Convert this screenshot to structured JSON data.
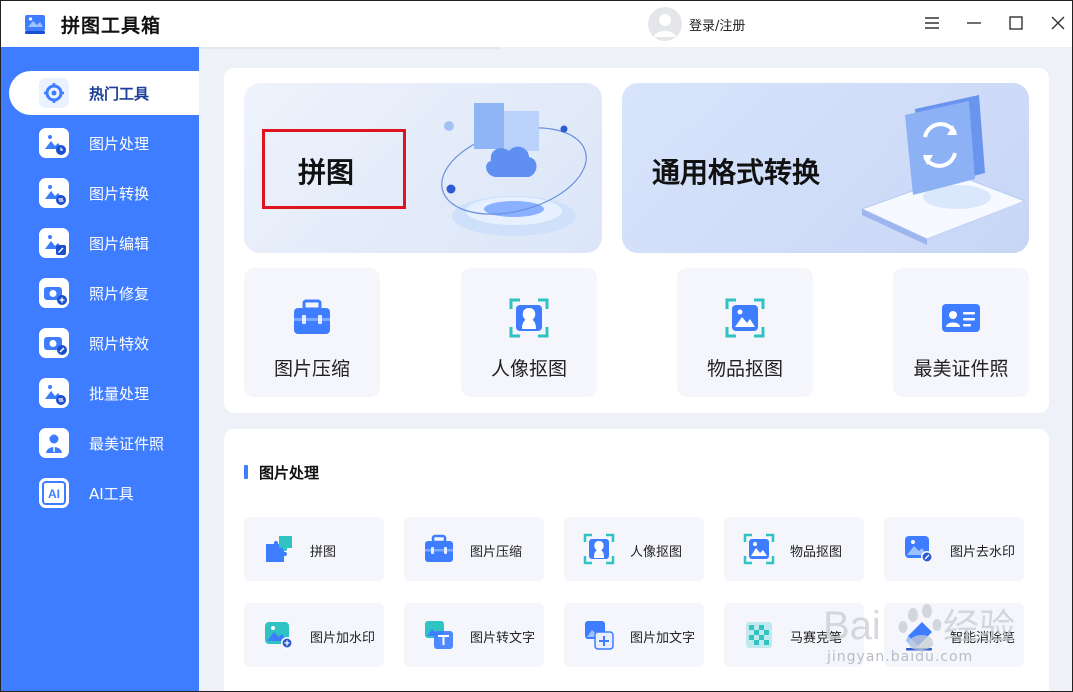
{
  "window": {
    "title": "拼图工具箱",
    "login_label": "登录/注册"
  },
  "sidebar": {
    "items": [
      {
        "label": "热门工具",
        "icon": "gear-tools-icon",
        "active": true
      },
      {
        "label": "图片处理",
        "icon": "image-clock-icon"
      },
      {
        "label": "图片转换",
        "icon": "image-convert-icon"
      },
      {
        "label": "图片编辑",
        "icon": "image-edit-icon"
      },
      {
        "label": "照片修复",
        "icon": "camera-plus-icon"
      },
      {
        "label": "照片特效",
        "icon": "camera-magic-icon"
      },
      {
        "label": "批量处理",
        "icon": "image-batch-icon"
      },
      {
        "label": "最美证件照",
        "icon": "id-person-icon"
      },
      {
        "label": "AI工具",
        "icon": "ai-icon"
      }
    ]
  },
  "hero": {
    "puzzle": {
      "label": "拼图",
      "icon": "puzzle-3d-icon"
    },
    "format": {
      "label": "通用格式转换",
      "icon": "format-convert-3d-icon"
    }
  },
  "top_tools": [
    {
      "label": "图片压缩",
      "icon": "toolbox-icon"
    },
    {
      "label": "人像抠图",
      "icon": "portrait-cutout-icon"
    },
    {
      "label": "物品抠图",
      "icon": "object-cutout-icon"
    },
    {
      "label": "最美证件照",
      "icon": "id-card-icon"
    }
  ],
  "section": {
    "title": "图片处理",
    "tools": [
      {
        "label": "拼图",
        "icon": "puzzle-icon"
      },
      {
        "label": "图片压缩",
        "icon": "toolbox-icon"
      },
      {
        "label": "人像抠图",
        "icon": "portrait-cutout-icon"
      },
      {
        "label": "物品抠图",
        "icon": "object-cutout-icon"
      },
      {
        "label": "图片去水印",
        "icon": "image-watermark-remove-icon"
      },
      {
        "label": "图片加水印",
        "icon": "image-watermark-add-icon"
      },
      {
        "label": "图片转文字",
        "icon": "image-to-text-icon"
      },
      {
        "label": "图片加文字",
        "icon": "image-add-text-icon"
      },
      {
        "label": "马赛克笔",
        "icon": "mosaic-icon"
      },
      {
        "label": "智能消除笔",
        "icon": "smart-eraser-icon"
      }
    ]
  },
  "watermark": {
    "text": "jingyan.baidu.com"
  },
  "colors": {
    "accent": "#3e7dff",
    "highlight": "#e0141e",
    "bg": "#eef1f7"
  }
}
